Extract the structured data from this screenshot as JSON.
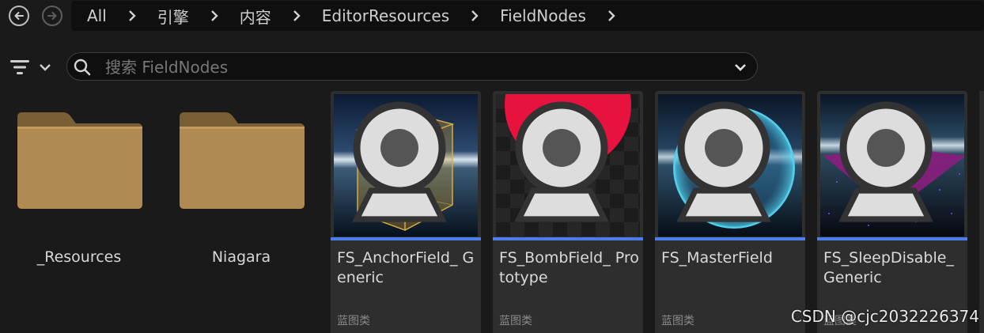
{
  "breadcrumb": {
    "items": [
      "All",
      "引擎",
      "内容",
      "EditorResources",
      "FieldNodes"
    ]
  },
  "search": {
    "placeholder": "搜索 FieldNodes",
    "value": ""
  },
  "folders": [
    {
      "label": "_Resources",
      "color": "#b08a52"
    },
    {
      "label": "Niagara",
      "color": "#b08a52"
    }
  ],
  "assets": [
    {
      "name": "FS_AnchorField_ Generic",
      "type": "蓝图类"
    },
    {
      "name": "FS_BombField_ Prototype",
      "type": "蓝图类"
    },
    {
      "name": "FS_MasterField",
      "type": "蓝图类"
    },
    {
      "name": "FS_SleepDisable_ Generic",
      "type": "蓝图类"
    }
  ],
  "colors": {
    "blueprint_bar": "#4b7ee8",
    "bomb_sphere": "#e8123f",
    "master_sphere": "#35b8e0",
    "sleep_plane": "#8a1e7e"
  },
  "icons": [
    "back-icon",
    "forward-icon",
    "chevron-right-icon",
    "filter-icon",
    "chevron-down-icon",
    "search-icon",
    "folder-icon",
    "camera-icon"
  ],
  "watermark": "CSDN @cjc2032226374"
}
